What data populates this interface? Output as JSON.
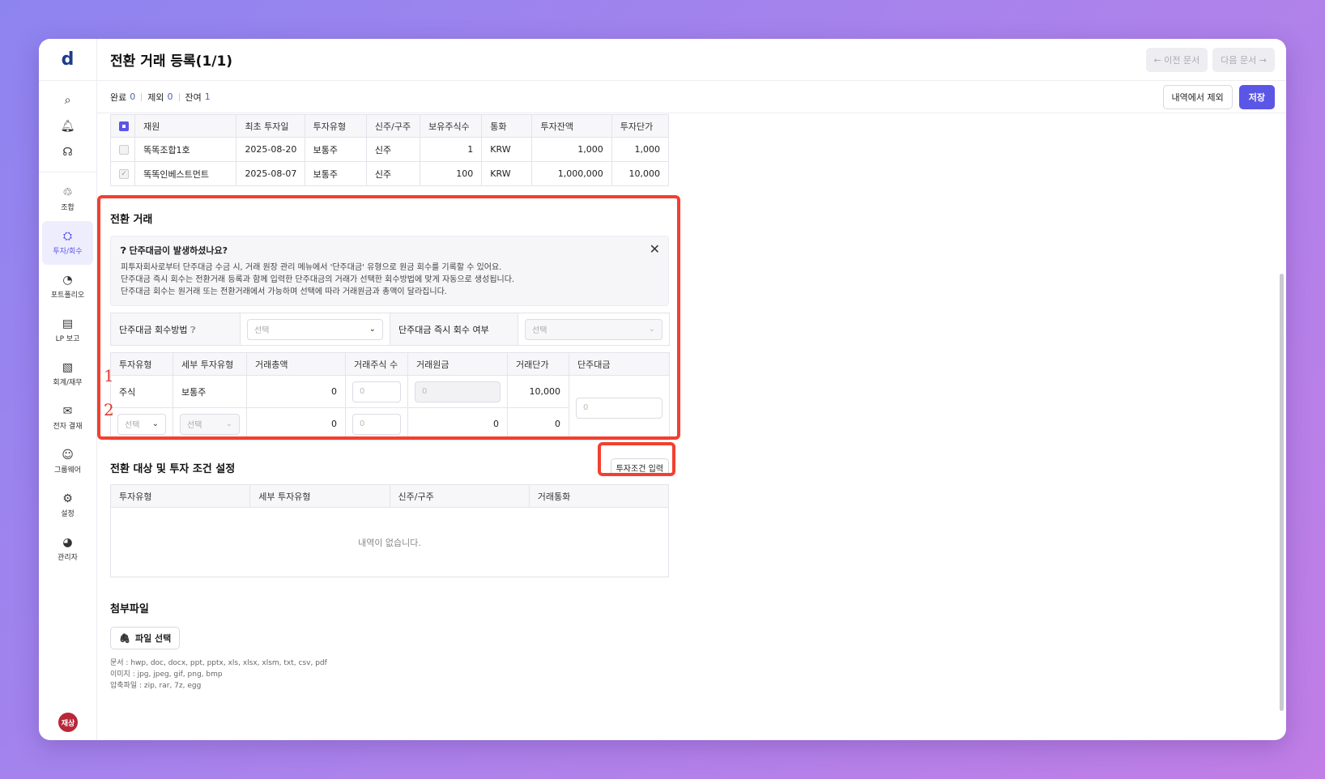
{
  "sidebar": {
    "logo": "d",
    "top_icons": [
      "search-icon",
      "bell-icon",
      "headset-icon"
    ],
    "items": [
      {
        "label": "조합",
        "icon": "♲"
      },
      {
        "label": "투자/회수",
        "icon": "⛭",
        "active": true
      },
      {
        "label": "포트폴리오",
        "icon": "◔"
      },
      {
        "label": "LP 보고",
        "icon": "▤"
      },
      {
        "label": "회계/재무",
        "icon": "▧"
      },
      {
        "label": "전자 결재",
        "icon": "✉"
      },
      {
        "label": "그룹웨어",
        "icon": "☺"
      },
      {
        "label": "설정",
        "icon": "⚙"
      },
      {
        "label": "관리자",
        "icon": "◕"
      }
    ],
    "avatar": "재상"
  },
  "header": {
    "title": "전환 거래 등록(1/1)",
    "prev_doc": "← 이전 문서",
    "next_doc": "다음 문서 →"
  },
  "subbar": {
    "done_label": "완료",
    "done_count": "0",
    "excluded_label": "제외",
    "excluded_count": "0",
    "remaining_label": "잔여",
    "remaining_count": "1",
    "exclude_button": "내역에서 제외",
    "save_button": "저장"
  },
  "holdings_table": {
    "headers": [
      "재원",
      "최초 투자일",
      "투자유형",
      "신주/구주",
      "보유주식수",
      "통화",
      "투자잔액",
      "투자단가"
    ],
    "rows": [
      {
        "fund": "똑똑조합1호",
        "date": "2025-08-20",
        "type": "보통주",
        "new_old": "신주",
        "shares": "1",
        "currency": "KRW",
        "balance": "1,000",
        "unit_price": "1,000"
      },
      {
        "fund": "똑똑인베스트먼트",
        "date": "2025-08-07",
        "type": "보통주",
        "new_old": "신주",
        "shares": "100",
        "currency": "KRW",
        "balance": "1,000,000",
        "unit_price": "10,000"
      }
    ]
  },
  "conversion": {
    "title": "전환 거래",
    "info": {
      "heading": "단주대금이 발생하셨나요?",
      "lines": [
        "피투자회사로부터 단주대금 수금 시, 거래 원장 관리 메뉴에서 '단주대금' 유형으로 원금 회수를 기록할 수 있어요.",
        "단주대금 즉시 회수는 전환거래 등록과 함께 입력한 단주대금의 거래가 선택한 회수방법에 맞게 자동으로 생성됩니다.",
        "단주대금 회수는 원거래 또는 전환거래에서 가능하며 선택에 따라 거래원금과 총액이 달라집니다."
      ]
    },
    "method_label": "단주대금 회수방법",
    "method_placeholder": "선택",
    "immediate_label": "단주대금 즉시 회수 여부",
    "immediate_placeholder": "선택",
    "table_headers": [
      "투자유형",
      "세부 투자유형",
      "거래총액",
      "거래주식 수",
      "거래원금",
      "거래단가",
      "단주대금"
    ],
    "row1": {
      "num": "1",
      "type": "주식",
      "subtype": "보통주",
      "total": "0",
      "shares_ph": "0",
      "principal_ph": "0",
      "unit_price": "10,000"
    },
    "row2": {
      "num": "2",
      "type_ph": "선택",
      "subtype_ph": "선택",
      "total": "0",
      "shares_ph": "0",
      "principal": "0",
      "unit_price": "0"
    },
    "fractional_ph": "0"
  },
  "target": {
    "title": "전환 대상 및 투자 조건 설정",
    "button": "투자조건 입력",
    "headers": [
      "투자유형",
      "세부 투자유형",
      "신주/구주",
      "거래통화"
    ],
    "empty": "내역이 없습니다."
  },
  "attachments": {
    "title": "첨부파일",
    "button": "파일 선택",
    "notes": [
      "문서 : hwp, doc, docx, ppt, pptx, xls, xlsx, xlsm, txt, csv, pdf",
      "이미지 : jpg, jpeg, gif, png, bmp",
      "압축파일 : zip, rar, 7z, egg"
    ]
  }
}
